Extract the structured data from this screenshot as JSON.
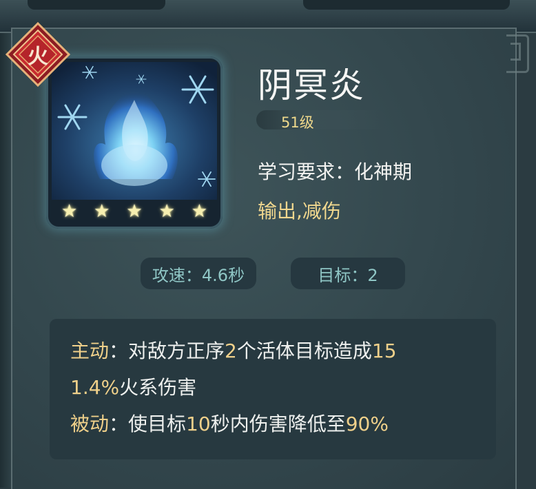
{
  "element_badge": {
    "label": "火",
    "color": "#c82b30"
  },
  "skill": {
    "name": "阴冥炎",
    "level": "51级",
    "requirement": "学习要求：化神期",
    "tags": "输出,减伤",
    "stars": 5,
    "art_icon": "blue-flame-snowflake-icon"
  },
  "stats": {
    "attack_speed": "攻速：4.6秒",
    "targets": "目标：2"
  },
  "description": {
    "active_label": "主动",
    "active_sep": "：",
    "active_p1": "对敌方正序",
    "active_num1": "2",
    "active_p2": "个活体目标造成",
    "active_num2a": "15",
    "active_num2b": "1.4%",
    "active_p3": "火系伤害",
    "passive_label": "被动",
    "passive_sep": "：",
    "passive_p1": "使目标",
    "passive_num1": "10",
    "passive_p2": "秒内伤害降低至",
    "passive_num2": "90%"
  },
  "colors": {
    "accent_gold": "#efd08a",
    "stat_text": "#8fc6c5",
    "panel": "#33474d"
  }
}
